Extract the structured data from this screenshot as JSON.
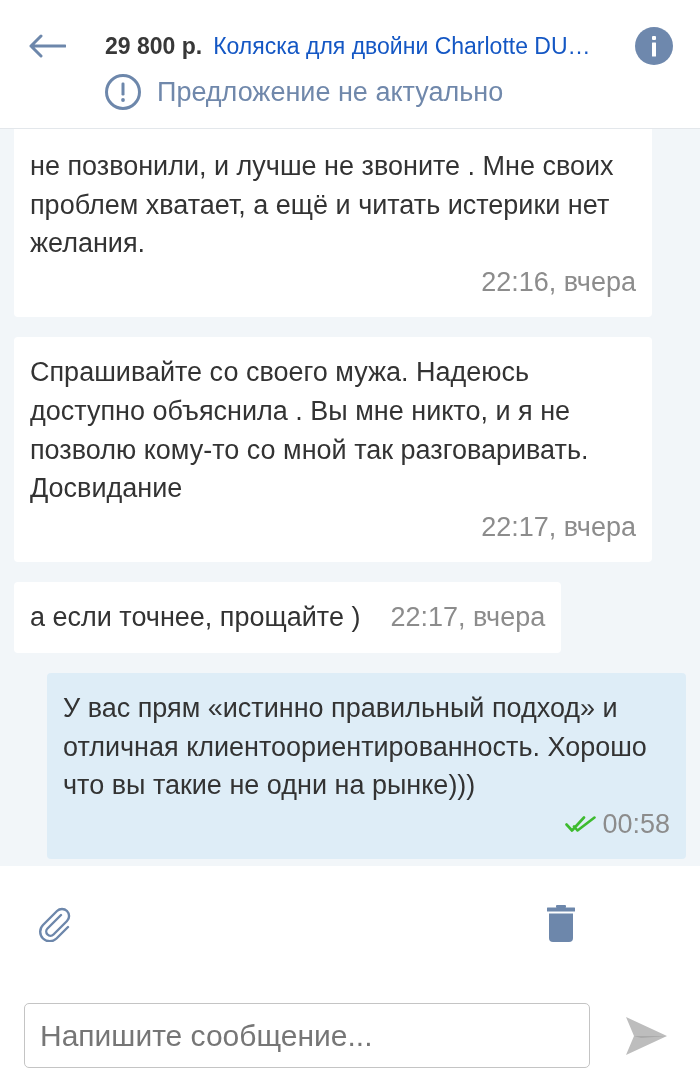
{
  "header": {
    "listing": {
      "price": "29 800 р.",
      "title": "Коляска для двойни Charlotte DU…"
    },
    "notice": "Предложение не актуально"
  },
  "messages": [
    {
      "kind": "incoming",
      "text": "не позвонили, и лучше не звоните . Мне своих проблем хватает, а ещё и читать истерики нет желания.",
      "time": "22:16, вчера"
    },
    {
      "kind": "incoming",
      "text": "Спрашивайте со своего мужа. Надеюсь доступно объяснила . Вы мне никто, и я не позволю кому-то со мной так разговаривать. Досвидание",
      "time": "22:17, вчера"
    },
    {
      "kind": "incoming",
      "text": "а если точнее, прощайте )",
      "time": "22:17, вчера"
    },
    {
      "kind": "outgoing",
      "text": "У вас прям «истинно правильный подход» и отличная клиентоориентированность. Хорошо что вы такие не одни на рынке)))",
      "time": "00:58",
      "read": true
    }
  ],
  "composer": {
    "placeholder": "Напишите сообщение..."
  }
}
